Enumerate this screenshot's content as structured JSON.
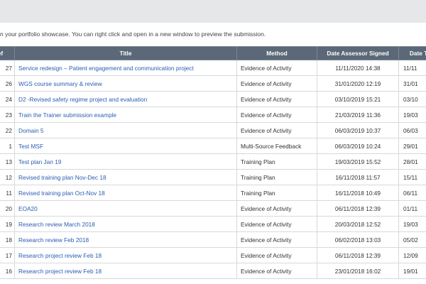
{
  "intro": {
    "text": "n your portfolio showcase. You can right click and open in a new window to preview the submission."
  },
  "table": {
    "headers": [
      "ef",
      "Title",
      "Method",
      "Date Assessor Signed",
      "Date Tr"
    ],
    "rows": [
      {
        "ref": "27",
        "title": "Service redesign – Patient engagement and communication project",
        "method": "Evidence of Activity",
        "signed": "11/11/2020 14:38",
        "date2": "11/11"
      },
      {
        "ref": "26",
        "title": "WGS course summary & review",
        "method": "Evidence of Activity",
        "signed": "31/01/2020 12:19",
        "date2": "31/01"
      },
      {
        "ref": "24",
        "title": "D2 -Revised safety regime project and evaluation",
        "method": "Evidence of Activity",
        "signed": "03/10/2019 15:21",
        "date2": "03/10"
      },
      {
        "ref": "23",
        "title": "Train the Trainer submission example",
        "method": "Evidence of Activity",
        "signed": "21/03/2019 11:36",
        "date2": "19/03"
      },
      {
        "ref": "22",
        "title": "Domain 5",
        "method": "Evidence of Activity",
        "signed": "06/03/2019 10:37",
        "date2": "06/03"
      },
      {
        "ref": "1",
        "title": "Test MSF",
        "method": "Multi-Source Feedback",
        "signed": "06/03/2019 10:24",
        "date2": "29/01"
      },
      {
        "ref": "13",
        "title": "Test plan Jan 19",
        "method": "Training Plan",
        "signed": "19/03/2019 15:52",
        "date2": "28/01"
      },
      {
        "ref": "12",
        "title": "Revised training plan Nov-Dec 18",
        "method": "Training Plan",
        "signed": "16/11/2018 11:57",
        "date2": "15/11"
      },
      {
        "ref": "11",
        "title": "Revised training plan Oct-Nov 18",
        "method": "Training Plan",
        "signed": "16/11/2018 10:49",
        "date2": "06/11"
      },
      {
        "ref": "20",
        "title": "EOA20",
        "method": "Evidence of Activity",
        "signed": "06/11/2018 12:39",
        "date2": "01/11"
      },
      {
        "ref": "19",
        "title": "Research review March 2018",
        "method": "Evidence of Activity",
        "signed": "20/03/2018 12:52",
        "date2": "19/03"
      },
      {
        "ref": "18",
        "title": "Research review Feb 2018",
        "method": "Evidence of Activity",
        "signed": "06/02/2018 13:03",
        "date2": "05/02"
      },
      {
        "ref": "17",
        "title": "Research project review Feb 18",
        "method": "Evidence of Activity",
        "signed": "06/11/2018 12:39",
        "date2": "12/09"
      },
      {
        "ref": "16",
        "title": "Research project review Feb 18",
        "method": "Evidence of Activity",
        "signed": "23/01/2018 16:02",
        "date2": "19/01"
      }
    ]
  }
}
